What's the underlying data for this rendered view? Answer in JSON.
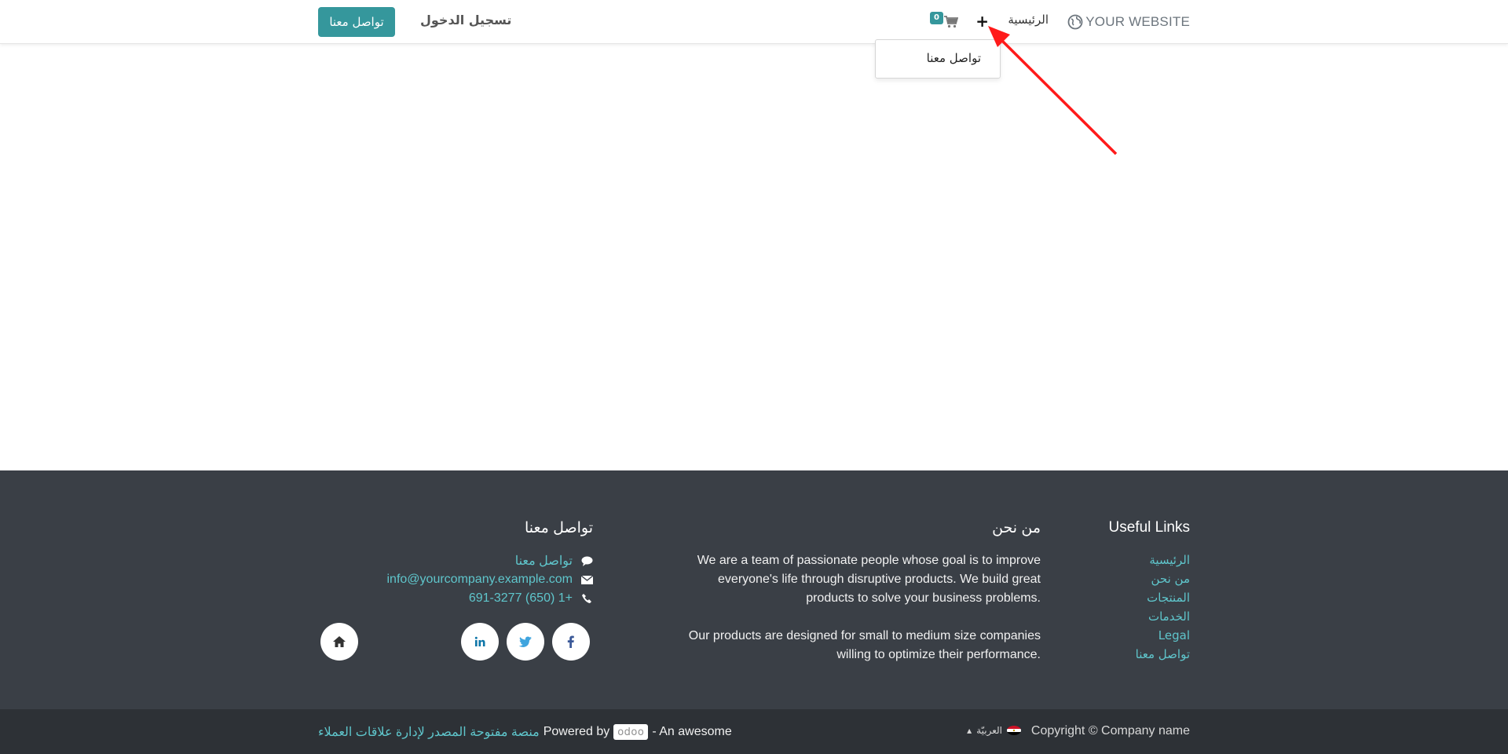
{
  "header": {
    "brand": "YOUR WEBSITE",
    "home": "الرئيسية",
    "plus_symbol": "+",
    "cart_count": "0",
    "login": "تسجيل الدخول",
    "cta": "تواصل معنا"
  },
  "dropdown": {
    "item": "تواصل معنا"
  },
  "footer": {
    "links_title": "Useful Links",
    "links": [
      "الرئيسية",
      "من نحن",
      "المنتجات",
      "الخدمات",
      "Legal",
      "تواصل معنا"
    ],
    "about_title": "من نحن",
    "about_p1": "We are a team of passionate people whose goal is to improve everyone's life through disruptive products. We build great products to solve your business problems.",
    "about_p2": "Our products are designed for small to medium size companies willing to optimize their performance.",
    "contact_title": "تواصل معنا",
    "contact_chat": "تواصل معنا",
    "contact_email": "info@yourcompany.example.com",
    "contact_phone": "+1 (650) 691-3277",
    "socials": [
      "facebook-icon",
      "twitter-icon",
      "linkedin-icon",
      "home-icon"
    ]
  },
  "bottom": {
    "copyright": "Copyright © Company name",
    "language": "العربيّة",
    "powered_prefix": "- An awesome",
    "powered_by": "Powered by",
    "odoo": "odoo",
    "powered_link": "منصة مفتوحة المصدر لإدارة علاقات العملاء"
  },
  "colors": {
    "accent": "#35979c",
    "footer_bg": "#3a3f46",
    "bottom_bg": "#2d3136",
    "link": "#5fc6cc",
    "annotation_arrow": "#ff1a1a"
  }
}
